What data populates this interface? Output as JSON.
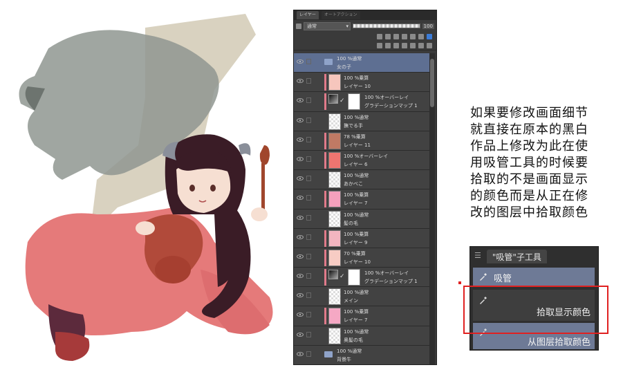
{
  "layer_panel": {
    "tabs": [
      "レイヤー",
      "オートアクション"
    ],
    "blend_mode": "通常",
    "opacity": "100",
    "layers": [
      {
        "blend": "100 %通常",
        "name": "女の子",
        "type": "folder",
        "selected": true
      },
      {
        "blend": "100 %乗算",
        "name": "レイヤー 10",
        "color": "#f6c6bd",
        "clip": true
      },
      {
        "blend": "100 %オーバーレイ",
        "name": "グラデーションマップ 1",
        "type": "gmap"
      },
      {
        "blend": "100 %通常",
        "name": "撫でる手",
        "color": "transparent"
      },
      {
        "blend": "78 %乗算",
        "name": "レイヤー 11",
        "color": "#c07a64",
        "clip": true
      },
      {
        "blend": "100 %オーバーレイ",
        "name": "レイヤー 6",
        "color": "#ef7570",
        "clip": true
      },
      {
        "blend": "100 %通常",
        "name": "あかべこ",
        "color": "transparent"
      },
      {
        "blend": "100 %乗算",
        "name": "レイヤー 7",
        "color": "#f5a0bc",
        "clip": true
      },
      {
        "blend": "100 %通常",
        "name": "髪の毛",
        "color": "transparent"
      },
      {
        "blend": "100 %乗算",
        "name": "レイヤー 9",
        "color": "#f2b5c0",
        "clip": true
      },
      {
        "blend": "70 %乗算",
        "name": "レイヤー 10",
        "color": "#f7ccc4",
        "clip": true
      },
      {
        "blend": "100 %オーバーレイ",
        "name": "グラデーションマップ 1",
        "type": "gmap"
      },
      {
        "blend": "100 %通常",
        "name": "メイン",
        "color": "transparent"
      },
      {
        "blend": "100 %乗算",
        "name": "レイヤー 7",
        "color": "#f5a8c4",
        "clip": true
      },
      {
        "blend": "100 %通常",
        "name": "奥髪の毛",
        "color": "transparent"
      },
      {
        "blend": "100 %通常",
        "name": "背景牛",
        "type": "folder"
      }
    ]
  },
  "explanation": {
    "lines": [
      "如果要修改画面细节",
      "就直接在原本的黑白",
      "作品上修改为此在使",
      "用吸管工具的时候要",
      "拾取的不是画面显示",
      "的颜色而是从正在修",
      "改的图层中拾取颜色"
    ]
  },
  "sub_tool": {
    "tab_label": "\"吸管\"子工具",
    "header_item": "吸管",
    "option1": "拾取显示颜色",
    "option2": "从图层拾取颜色"
  },
  "colors": {
    "highlight_box": "#e02020",
    "selected_layer": "#5e6f92",
    "panel_bg": "#3a3a3a"
  }
}
